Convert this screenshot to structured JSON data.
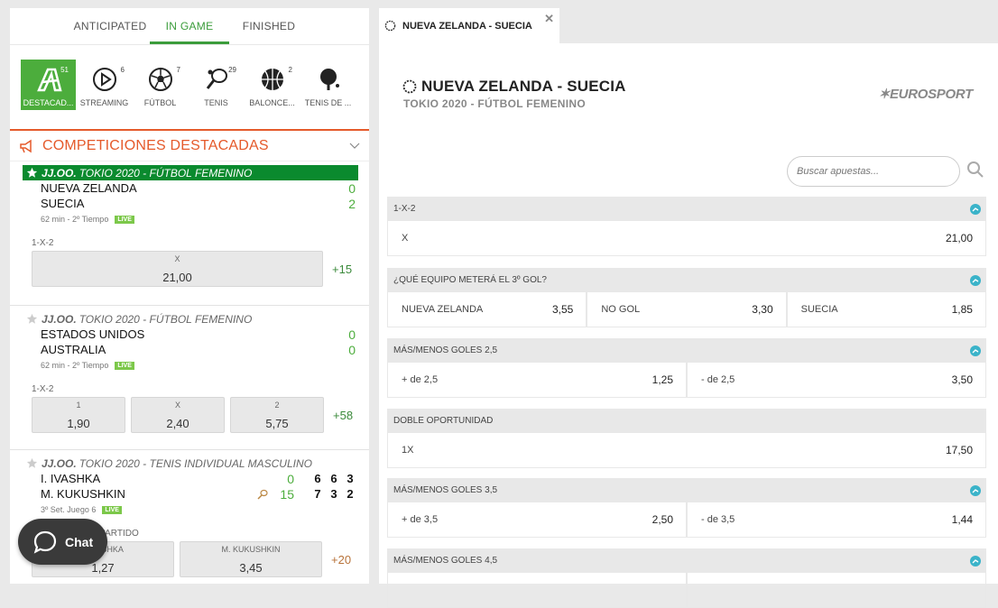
{
  "tabs": {
    "anticipated": "ANTICIPATED",
    "in_game": "IN GAME",
    "finished": "FINISHED"
  },
  "sports": [
    {
      "label": "DESTACAD...",
      "count": "51",
      "icon": "featured-icon"
    },
    {
      "label": "STREAMING",
      "count": "6",
      "icon": "play-icon"
    },
    {
      "label": "FÚTBOL",
      "count": "7",
      "icon": "soccer-ball-icon"
    },
    {
      "label": "TENIS",
      "count": "29",
      "icon": "tennis-icon"
    },
    {
      "label": "BALONCE...",
      "count": "2",
      "icon": "basketball-icon"
    },
    {
      "label": "TENIS DE ...",
      "count": "",
      "icon": "table-tennis-icon"
    }
  ],
  "featured": {
    "title": "COMPETICIONES DESTACADAS"
  },
  "events": [
    {
      "league": "JJ.OO.",
      "comp": "TOKIO 2020 - FÚTBOL FEMENINO",
      "team1": "NUEVA ZELANDA",
      "team2": "SUECIA",
      "score1": "0",
      "score2": "2",
      "time": "62 min - 2º Tiempo",
      "live": "LIVE",
      "market": "1-X-2",
      "odds": [
        {
          "label": "X",
          "value": "21,00"
        }
      ],
      "more": "+15"
    },
    {
      "league": "JJ.OO.",
      "comp": "TOKIO 2020 - FÚTBOL FEMENINO",
      "team1": "ESTADOS UNIDOS",
      "team2": "AUSTRALIA",
      "score1": "0",
      "score2": "0",
      "time": "62 min - 2º Tiempo",
      "live": "LIVE",
      "market": "1-X-2",
      "odds": [
        {
          "label": "1",
          "value": "1,90"
        },
        {
          "label": "X",
          "value": "2,40"
        },
        {
          "label": "2",
          "value": "5,75"
        }
      ],
      "more": "+58"
    },
    {
      "league": "JJ.OO.",
      "comp": "TOKIO 2020 - TENIS INDIVIDUAL MASCULINO",
      "team1": "I. IVASHKA",
      "team2": "M. KUKUSHKIN",
      "score1": "0",
      "score2": "15",
      "sets1": [
        "6",
        "6",
        "3"
      ],
      "sets2": [
        "7",
        "3",
        "2"
      ],
      "time": "3º Set. Juego 6",
      "live": "LIVE",
      "market": "GANADOR DEL PARTIDO",
      "odds": [
        {
          "label": "I. IVASHKA",
          "value": "1,27"
        },
        {
          "label": "M. KUKUSHKIN",
          "value": "3,45"
        }
      ],
      "more": "+20"
    }
  ],
  "chat": {
    "label": "Chat"
  },
  "right": {
    "tab_title": "NUEVA ZELANDA - SUECIA",
    "title": "NUEVA ZELANDA - SUECIA",
    "subtitle": "TOKIO 2020 - FÚTBOL FEMENINO",
    "brand": "EUROSPORT",
    "search_placeholder": "Buscar apuestas...",
    "markets": [
      {
        "title": "1-X-2",
        "cells": [
          {
            "label": "X",
            "value": "21,00"
          }
        ]
      },
      {
        "title": "¿QUÉ EQUIPO METERÁ EL 3º GOL?",
        "cells": [
          {
            "label": "NUEVA ZELANDA",
            "value": "3,55"
          },
          {
            "label": "NO GOL",
            "value": "3,30"
          },
          {
            "label": "SUECIA",
            "value": "1,85"
          }
        ]
      },
      {
        "title": "MÁS/MENOS GOLES 2,5",
        "cells": [
          {
            "label": "+ de 2,5",
            "value": "1,25"
          },
          {
            "label": "- de 2,5",
            "value": "3,50"
          }
        ]
      },
      {
        "title": "DOBLE OPORTUNIDAD",
        "cells": [
          {
            "label": "1X",
            "value": "17,50"
          }
        ]
      },
      {
        "title": "MÁS/MENOS GOLES 3,5",
        "cells": [
          {
            "label": "+ de 3,5",
            "value": "2,50"
          },
          {
            "label": "- de 3,5",
            "value": "1,44"
          }
        ]
      },
      {
        "title": "MÁS/MENOS GOLES 4,5",
        "cells": [
          {
            "label": "",
            "value": ""
          },
          {
            "label": "",
            "value": ""
          }
        ]
      }
    ]
  },
  "colors": {
    "accent": "#4cad3c",
    "featured": "#e55a2b",
    "live": "#7cc84a",
    "header_green": "#0a8a2e"
  }
}
